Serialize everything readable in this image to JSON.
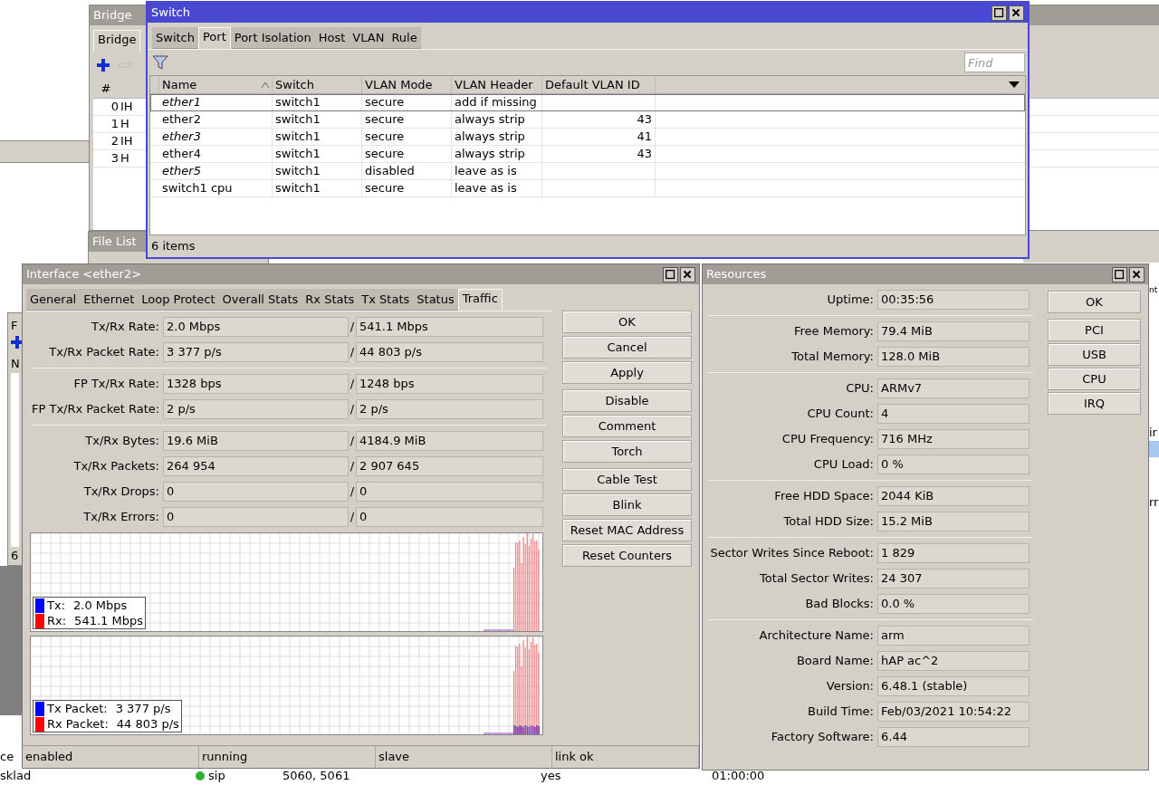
{
  "bridge_window": {
    "title": "Bridge",
    "tabs": [
      {
        "label": "Bridge",
        "selected": true
      }
    ],
    "columns": [
      "#"
    ],
    "rows": [
      {
        "index": "0",
        "flags": "IH"
      },
      {
        "index": "1",
        "flags": "H"
      },
      {
        "index": "2",
        "flags": "IH"
      },
      {
        "index": "3",
        "flags": "H"
      }
    ]
  },
  "file_list_window": {
    "title": "File List"
  },
  "left_window": {
    "tab": "F",
    "column": "N",
    "count": "6"
  },
  "switch_window": {
    "title": "Switch",
    "tabs": [
      {
        "label": "Switch",
        "selected": false
      },
      {
        "label": "Port",
        "selected": true
      },
      {
        "label": "Port Isolation",
        "selected": false
      },
      {
        "label": "Host",
        "selected": false
      },
      {
        "label": "VLAN",
        "selected": false
      },
      {
        "label": "Rule",
        "selected": false
      }
    ],
    "find_placeholder": "Find",
    "columns": [
      "Name",
      "Switch",
      "VLAN Mode",
      "VLAN Header",
      "Default VLAN ID"
    ],
    "rows": [
      {
        "name": "ether1",
        "inactive": true,
        "selected": true,
        "switch": "switch1",
        "vlan_mode": "secure",
        "vlan_header": "add if missing",
        "default_vlan_id": ""
      },
      {
        "name": "ether2",
        "inactive": false,
        "selected": false,
        "switch": "switch1",
        "vlan_mode": "secure",
        "vlan_header": "always strip",
        "default_vlan_id": "43"
      },
      {
        "name": "ether3",
        "inactive": true,
        "selected": false,
        "switch": "switch1",
        "vlan_mode": "secure",
        "vlan_header": "always strip",
        "default_vlan_id": "41"
      },
      {
        "name": "ether4",
        "inactive": false,
        "selected": false,
        "switch": "switch1",
        "vlan_mode": "secure",
        "vlan_header": "always strip",
        "default_vlan_id": "43"
      },
      {
        "name": "ether5",
        "inactive": true,
        "selected": false,
        "switch": "switch1",
        "vlan_mode": "disabled",
        "vlan_header": "leave as is",
        "default_vlan_id": ""
      },
      {
        "name": "switch1 cpu",
        "inactive": false,
        "selected": false,
        "switch": "switch1",
        "vlan_mode": "secure",
        "vlan_header": "leave as is",
        "default_vlan_id": ""
      }
    ],
    "status": "6 items"
  },
  "interface_window": {
    "title": "Interface <ether2>",
    "tabs": [
      {
        "label": "General",
        "selected": false
      },
      {
        "label": "Ethernet",
        "selected": false
      },
      {
        "label": "Loop Protect",
        "selected": false
      },
      {
        "label": "Overall Stats",
        "selected": false
      },
      {
        "label": "Rx Stats",
        "selected": false
      },
      {
        "label": "Tx Stats",
        "selected": false
      },
      {
        "label": "Status",
        "selected": false
      },
      {
        "label": "Traffic",
        "selected": true
      }
    ],
    "field_groups": [
      [
        {
          "label": "Tx/Rx Rate:",
          "tx": "2.0 Mbps",
          "rx": "541.1 Mbps"
        },
        {
          "label": "Tx/Rx Packet Rate:",
          "tx": "3 377 p/s",
          "rx": "44 803 p/s"
        }
      ],
      [
        {
          "label": "FP Tx/Rx Rate:",
          "tx": "1328 bps",
          "rx": "1248 bps"
        },
        {
          "label": "FP Tx/Rx Packet Rate:",
          "tx": "2 p/s",
          "rx": "2 p/s"
        }
      ],
      [
        {
          "label": "Tx/Rx Bytes:",
          "tx": "19.6 MiB",
          "rx": "4184.9 MiB"
        },
        {
          "label": "Tx/Rx Packets:",
          "tx": "264 954",
          "rx": "2 907 645"
        },
        {
          "label": "Tx/Rx Drops:",
          "tx": "0",
          "rx": "0"
        },
        {
          "label": "Tx/Rx Errors:",
          "tx": "0",
          "rx": "0"
        }
      ]
    ],
    "separator": "/",
    "graphs": [
      {
        "legend": [
          {
            "label": "Tx:",
            "value": "2.0 Mbps",
            "color": "#0000ff"
          },
          {
            "label": "Rx:",
            "value": "541.1 Mbps",
            "color": "#ff0000"
          }
        ]
      },
      {
        "legend": [
          {
            "label": "Tx Packet:",
            "value": "3 377 p/s",
            "color": "#0000ff"
          },
          {
            "label": "Rx Packet:",
            "value": "44 803 p/s",
            "color": "#ff0000"
          }
        ]
      }
    ],
    "button_groups": [
      [
        "OK",
        "Cancel",
        "Apply"
      ],
      [
        "Disable",
        "Comment",
        "Torch"
      ],
      [
        "Cable Test",
        "Blink",
        "Reset MAC Address",
        "Reset Counters"
      ]
    ],
    "status_bar": [
      "enabled",
      "running",
      "slave",
      "link ok"
    ]
  },
  "resources_window": {
    "title": "Resources",
    "field_groups": [
      [
        {
          "label": "Uptime:",
          "value": "00:35:56"
        }
      ],
      [
        {
          "label": "Free Memory:",
          "value": "79.4 MiB"
        },
        {
          "label": "Total Memory:",
          "value": "128.0 MiB"
        }
      ],
      [
        {
          "label": "CPU:",
          "value": "ARMv7"
        },
        {
          "label": "CPU Count:",
          "value": "4"
        },
        {
          "label": "CPU Frequency:",
          "value": "716 MHz"
        },
        {
          "label": "CPU Load:",
          "value": "0 %"
        }
      ],
      [
        {
          "label": "Free HDD Space:",
          "value": "2044 KiB"
        },
        {
          "label": "Total HDD Size:",
          "value": "15.2 MiB"
        }
      ],
      [
        {
          "label": "Sector Writes Since Reboot:",
          "value": "1 829"
        },
        {
          "label": "Total Sector Writes:",
          "value": "24 307"
        },
        {
          "label": "Bad Blocks:",
          "value": "0.0 %"
        }
      ],
      [
        {
          "label": "Architecture Name:",
          "value": "arm"
        },
        {
          "label": "Board Name:",
          "value": "hAP ac^2"
        },
        {
          "label": "Version:",
          "value": "6.48.1 (stable)"
        },
        {
          "label": "Build Time:",
          "value": "Feb/03/2021 10:54:22"
        },
        {
          "label": "Factory Software:",
          "value": "6.44"
        }
      ]
    ],
    "buttons": [
      "OK",
      "PCI",
      "USB",
      "CPU",
      "IRQ"
    ]
  },
  "right_fragments": [
    "nt",
    "ir",
    "rr"
  ],
  "bottom_rows": [
    {
      "column_1": "ce"
    },
    {
      "column_1": "sklad",
      "column_2": "sip",
      "column_3": "5060, 5061",
      "column_4": "yes",
      "column_5": "01:00:00"
    }
  ]
}
